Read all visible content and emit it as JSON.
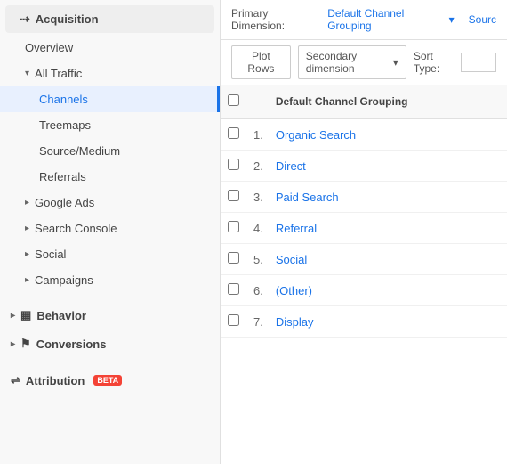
{
  "sidebar": {
    "items": [
      {
        "id": "acquisition",
        "label": "Acquisition",
        "level": "level0",
        "icon": "acquisition-icon",
        "chevron": true
      },
      {
        "id": "overview",
        "label": "Overview",
        "level": "level1",
        "icon": null,
        "chevron": false
      },
      {
        "id": "all-traffic",
        "label": "All Traffic",
        "level": "level1",
        "icon": null,
        "chevron": true,
        "expanded": true
      },
      {
        "id": "channels",
        "label": "Channels",
        "level": "level2",
        "icon": null,
        "chevron": false,
        "active": true
      },
      {
        "id": "treemaps",
        "label": "Treemaps",
        "level": "level2",
        "icon": null,
        "chevron": false
      },
      {
        "id": "source-medium",
        "label": "Source/Medium",
        "level": "level2",
        "icon": null,
        "chevron": false
      },
      {
        "id": "referrals",
        "label": "Referrals",
        "level": "level2",
        "icon": null,
        "chevron": false
      },
      {
        "id": "google-ads",
        "label": "Google Ads",
        "level": "level1",
        "icon": null,
        "chevron": true
      },
      {
        "id": "search-console",
        "label": "Search Console",
        "level": "level1",
        "icon": null,
        "chevron": true
      },
      {
        "id": "social",
        "label": "Social",
        "level": "level1",
        "icon": null,
        "chevron": true
      },
      {
        "id": "campaigns",
        "label": "Campaigns",
        "level": "level1",
        "icon": null,
        "chevron": true
      },
      {
        "id": "behavior",
        "label": "Behavior",
        "level": "level0-behavior",
        "icon": "behavior-icon",
        "chevron": true
      },
      {
        "id": "conversions",
        "label": "Conversions",
        "level": "level0-conversions",
        "icon": "conversions-icon",
        "chevron": true
      },
      {
        "id": "attribution",
        "label": "Attribution",
        "level": "level0-attribution",
        "icon": "attribution-icon",
        "chevron": false,
        "beta": true
      }
    ]
  },
  "primary_dimension": {
    "label": "Primary Dimension:",
    "selected": "Default Channel Grouping",
    "alt_link": "Sourc"
  },
  "toolbar": {
    "plot_rows": "Plot Rows",
    "secondary_dim": "Secondary dimension",
    "sort_type_label": "Sort Type:"
  },
  "table": {
    "header": {
      "checkbox": "",
      "channel_grouping": "Default Channel Grouping"
    },
    "rows": [
      {
        "num": 1,
        "label": "Organic Search"
      },
      {
        "num": 2,
        "label": "Direct"
      },
      {
        "num": 3,
        "label": "Paid Search"
      },
      {
        "num": 4,
        "label": "Referral"
      },
      {
        "num": 5,
        "label": "Social"
      },
      {
        "num": 6,
        "label": "(Other)"
      },
      {
        "num": 7,
        "label": "Display"
      }
    ]
  }
}
